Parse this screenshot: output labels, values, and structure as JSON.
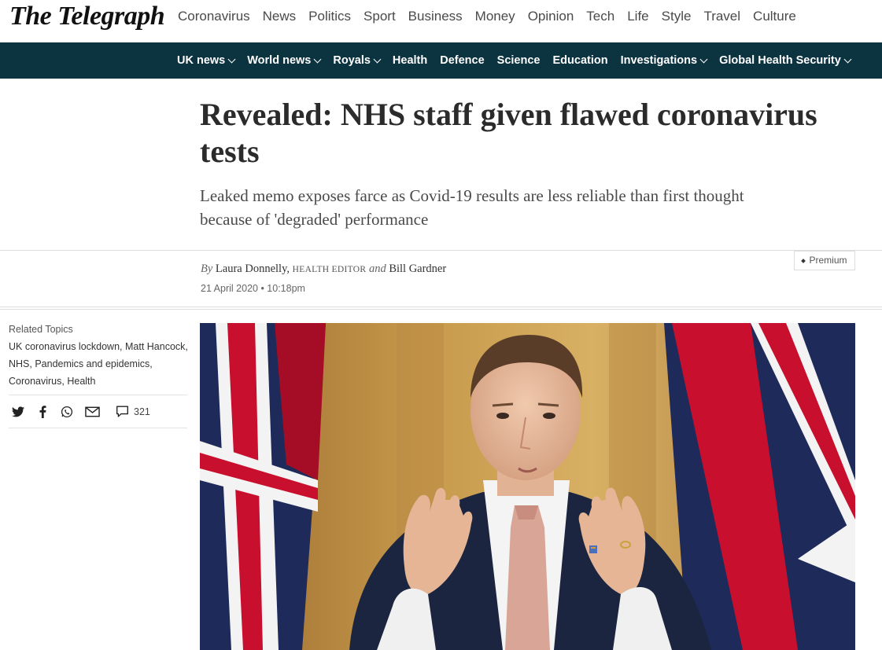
{
  "site": {
    "logo_text": "The Telegraph",
    "main_nav": [
      "Coronavirus",
      "News",
      "Politics",
      "Sport",
      "Business",
      "Money",
      "Opinion",
      "Tech",
      "Life",
      "Style",
      "Travel",
      "Culture"
    ],
    "active_section": "News",
    "sub_nav": [
      {
        "label": "UK news",
        "dropdown": true
      },
      {
        "label": "World news",
        "dropdown": true
      },
      {
        "label": "Royals",
        "dropdown": true
      },
      {
        "label": "Health",
        "dropdown": false
      },
      {
        "label": "Defence",
        "dropdown": false
      },
      {
        "label": "Science",
        "dropdown": false
      },
      {
        "label": "Education",
        "dropdown": false
      },
      {
        "label": "Investigations",
        "dropdown": true
      },
      {
        "label": "Global Health Security",
        "dropdown": true
      }
    ]
  },
  "article": {
    "headline": "Revealed: NHS staff given flawed coronavirus tests",
    "standfirst": "Leaked memo exposes farce as Covid-19 results are less reliable than first thought because of 'degraded' performance",
    "premium_label": "Premium",
    "byline": {
      "by": "By",
      "author1": "Laura Donnelly,",
      "role": "HEALTH EDITOR",
      "and": "and",
      "author2": "Bill Gardner"
    },
    "date": "21 April 2020 • 10:18pm"
  },
  "sidebar": {
    "related_title": "Related Topics",
    "related_topics": "UK coronavirus lockdown, Matt Hancock, NHS, Pandemics and epidemics, Coronavirus, Health",
    "share_icons": [
      "twitter-icon",
      "facebook-icon",
      "whatsapp-icon",
      "email-icon",
      "comment-icon"
    ],
    "comment_count": "321"
  },
  "colors": {
    "brand_teal": "#0a8f8b",
    "subnav_bg": "#0c3340"
  }
}
